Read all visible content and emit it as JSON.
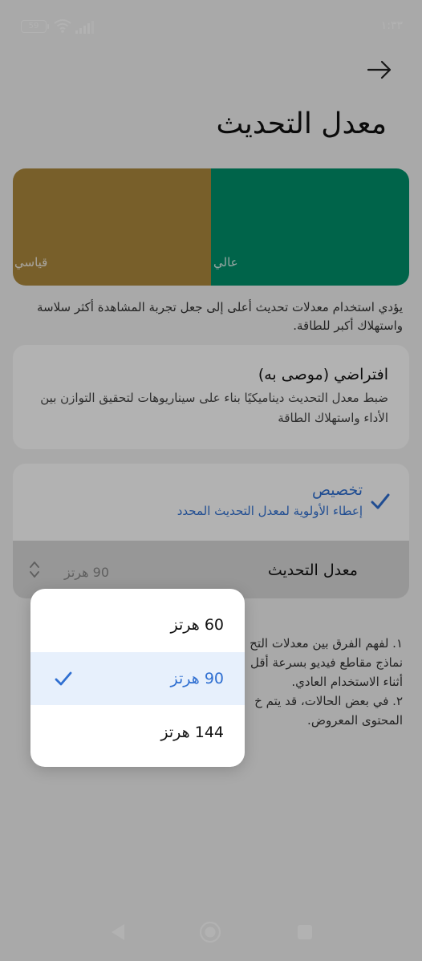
{
  "status_bar": {
    "battery": "59",
    "time": "١:٣٣"
  },
  "header": {
    "title": "معدل التحديث"
  },
  "preview": {
    "standard_label": "قياسي",
    "high_label": "عالي",
    "standard_color": "#ad893d",
    "high_color": "#00906b"
  },
  "description": "يؤدي استخدام معدلات تحديث أعلى إلى جعل تجربة المشاهدة أكثر سلاسة واستهلاك أكبر للطاقة.",
  "default_option": {
    "title": "افتراضي (موصى به)",
    "subtitle": "ضبط معدل التحديث ديناميكيًا بناء على سيناريوهات لتحقيق التوازن بين الأداء واستهلاك الطاقة"
  },
  "custom_option": {
    "title": "تخصيص",
    "subtitle": "إعطاء الأولوية لمعدل التحديث المحدد",
    "selected": true,
    "rate_label": "معدل التحديث",
    "rate_value": "90 هرتز"
  },
  "notes": {
    "line1": "١. لفهم الفرق بين معدلات التح",
    "line2": "نماذج مقاطع فيديو بسرعة أقل",
    "line3": "أثناء الاستخدام العادي.",
    "line4": "٢. في بعض الحالات، قد يتم خ",
    "line5": "المحتوى المعروض."
  },
  "dropdown": {
    "options": [
      {
        "label": "60 هرتز",
        "selected": false
      },
      {
        "label": "90 هرتز",
        "selected": true
      },
      {
        "label": "144 هرتز",
        "selected": false
      }
    ]
  },
  "accent_color": "#2f6fd1"
}
